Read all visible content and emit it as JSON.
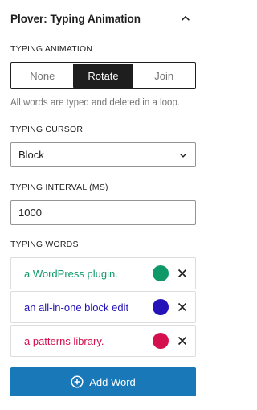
{
  "header": {
    "title": "Plover: Typing Animation",
    "collapse_icon": "chevron-up-icon"
  },
  "typing_animation": {
    "label": "TYPING ANIMATION",
    "options": [
      "None",
      "Rotate",
      "Join"
    ],
    "selected": "Rotate",
    "help": "All words are typed and deleted in a loop."
  },
  "typing_cursor": {
    "label": "TYPING CURSOR",
    "value": "Block",
    "dropdown_icon": "chevron-down-icon"
  },
  "typing_interval": {
    "label": "TYPING INTERVAL (MS)",
    "value": "1000"
  },
  "typing_words": {
    "label": "TYPING WORDS",
    "items": [
      {
        "text": "a WordPress plugin.",
        "color": "#0f9968"
      },
      {
        "text": "an all-in-one block edit",
        "color": "#2512b8"
      },
      {
        "text": "a patterns library.",
        "color": "#d4104f"
      }
    ],
    "remove_icon": "close-icon"
  },
  "add_button": {
    "label": "Add Word",
    "icon": "plus-circle-icon",
    "color": "#1878b8"
  }
}
